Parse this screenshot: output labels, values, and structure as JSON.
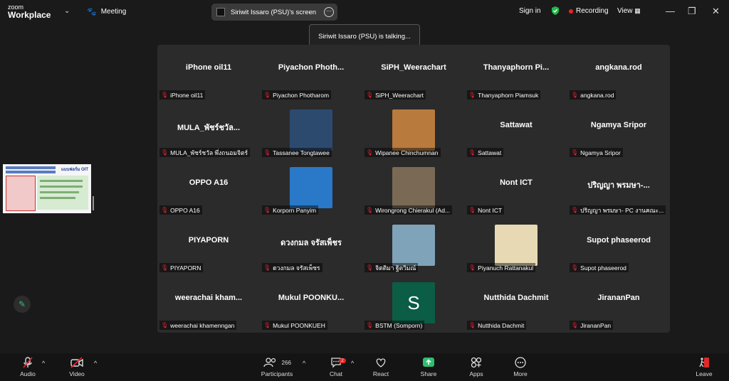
{
  "app": {
    "logo_line1": "zoom",
    "logo_line2": "Workplace",
    "meeting_label": "Meeting"
  },
  "share": {
    "title": "Siriwit Issaro (PSU)'s screen"
  },
  "header": {
    "sign_in": "Sign in",
    "recording": "Recording",
    "view": "View"
  },
  "toast": {
    "text": "Siriwit Issaro (PSU) is talking..."
  },
  "tiles": [
    {
      "big": "iPhone oil11",
      "label": "iPhone oil11"
    },
    {
      "big": "Piyachon Photh...",
      "label": "Piyachon Photharom"
    },
    {
      "big": "SiPH_Weerachart",
      "label": "SiPH_Weerachart"
    },
    {
      "big": "Thanyaphorn Pi...",
      "label": "Thanyaphorn Piamsuk"
    },
    {
      "big": "angkana.rod",
      "label": "angkana.rod"
    },
    {
      "big": "MULA_พัชร์ชวัล...",
      "label": "MULA_พัชร์ชวัล พึ่งถนอมจิตร์"
    },
    {
      "big": "",
      "label": "Tassanee Tongtawee",
      "photo": "#2c4a6e"
    },
    {
      "big": "",
      "label": "Wipanee Chinchumnan",
      "photo": "#b97a3e"
    },
    {
      "big": "Sattawat",
      "label": "Sattawat"
    },
    {
      "big": "Ngamya Sripor",
      "label": "Ngamya Sripor"
    },
    {
      "big": "OPPO A16",
      "label": "OPPO A16"
    },
    {
      "big": "",
      "label": "Korporn Panyim",
      "photo": "#2a78c8"
    },
    {
      "big": "",
      "label": "Wirongrong Chierakul (Ad...",
      "photo": "#7a6a55"
    },
    {
      "big": "Nont ICT",
      "label": "Nont ICT"
    },
    {
      "big": "ปริญญา พรมษา-...",
      "label": "ปริญญา พรมษา- PC งานคณะ..."
    },
    {
      "big": "PIYAPORN",
      "label": "PIYAPORN"
    },
    {
      "big": "ดวงกมล จรัสเพ็ชร",
      "label": "ดวงกมล จรัสเพ็ชร"
    },
    {
      "big": "",
      "label": "จิตติมา ฐิตวิมณ์",
      "photo": "#7fa3b8"
    },
    {
      "big": "",
      "label": "Piyanuch Rattanakul",
      "photo": "#e8d9b5"
    },
    {
      "big": "Supot phaseerod",
      "label": "Supot phaseerod"
    },
    {
      "big": "weerachai kham...",
      "label": "weerachai khamenngan"
    },
    {
      "big": "Mukul POONKU...",
      "label": "Mukul POONKUEH"
    },
    {
      "big": "",
      "label": "BSTM (Somporn)",
      "letter": "S"
    },
    {
      "big": "Nutthida Dachmit",
      "label": "Nutthida Dachmit"
    },
    {
      "big": "JirananPan",
      "label": "JirananPan"
    }
  ],
  "toolbar": {
    "audio": "Audio",
    "video": "Video",
    "participants": "Participants",
    "participants_count": "266",
    "chat": "Chat",
    "chat_badge": "2",
    "react": "React",
    "share": "Share",
    "apps": "Apps",
    "more": "More",
    "leave": "Leave"
  },
  "thumbnail": {
    "header": "แบบฟอร์ม OIT"
  },
  "colors": {
    "share_green": "#2fbf71",
    "recording_red": "#ee2222",
    "leave_red": "#e02828",
    "shield_green": "#1fb84a"
  },
  "icons": [
    "mic-off-icon",
    "video-off-icon",
    "participants-icon",
    "chat-icon",
    "react-icon",
    "share-icon",
    "apps-icon",
    "more-icon",
    "leave-icon",
    "shield-icon",
    "pen-icon"
  ]
}
